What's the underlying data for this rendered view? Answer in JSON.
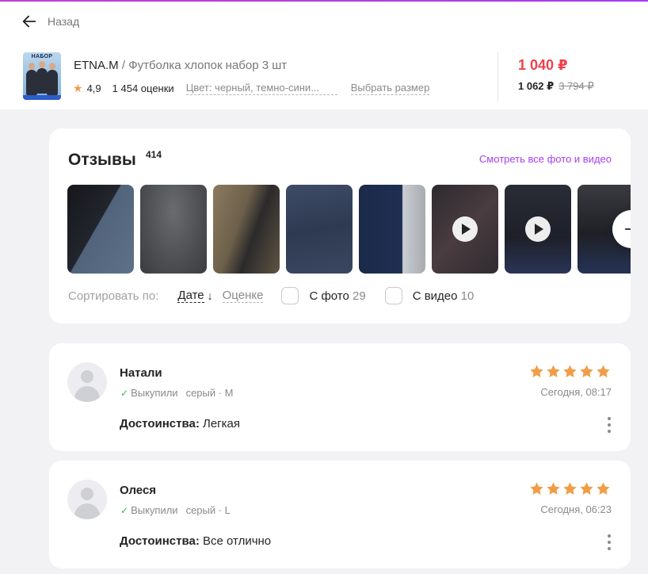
{
  "nav": {
    "back_label": "Назад"
  },
  "product": {
    "thumb_title": "НАБОР",
    "brand": "ETNA.M",
    "separator": " / ",
    "name": "Футболка хлопок набор 3 шт",
    "rating": "4,9",
    "ratings_count": "1 454 оценки",
    "color": "Цвет: черный, темно-сини...",
    "size_link": "Выбрать размер"
  },
  "price": {
    "current": "1 040 ₽",
    "wallet": "1 062 ₽",
    "old": "3 794 ₽"
  },
  "reviews_block": {
    "title": "Отзывы",
    "count": "414",
    "all_media_link": "Смотреть все фото и видео",
    "sort_label": "Сортировать по:",
    "sort_date": "Дате",
    "sort_date_arrow": "↓",
    "sort_rating": "Оценке",
    "filter_photo_label": "С фото",
    "filter_photo_count": "29",
    "filter_video_label": "С видео",
    "filter_video_count": "10",
    "media": [
      {
        "kind": "photo",
        "color": "#2f3e52"
      },
      {
        "kind": "photo",
        "color": "#55565a"
      },
      {
        "kind": "photo",
        "color": "#6b5e49"
      },
      {
        "kind": "photo",
        "color": "#33405a"
      },
      {
        "kind": "photo",
        "color": "#1f2d4e"
      },
      {
        "kind": "video",
        "color": "#3b3438"
      },
      {
        "kind": "video",
        "color": "#24262f"
      },
      {
        "kind": "photo",
        "color": "#2a2b31"
      }
    ]
  },
  "reviews": [
    {
      "author": "Натали",
      "bought": "Выкупили",
      "variant": "серый · M",
      "stars": 5,
      "date": "Сегодня, 08:17",
      "pros_label": "Достоинства:",
      "pros_text": "Легкая"
    },
    {
      "author": "Олеся",
      "bought": "Выкупили",
      "variant": "серый · L",
      "stars": 5,
      "date": "Сегодня, 06:23",
      "pros_label": "Достоинства:",
      "pros_text": "Все отлично"
    }
  ],
  "colors": {
    "accent": "#a63ff0",
    "price": "#f0404a",
    "star": "#f29c48",
    "check": "#36b84f"
  }
}
